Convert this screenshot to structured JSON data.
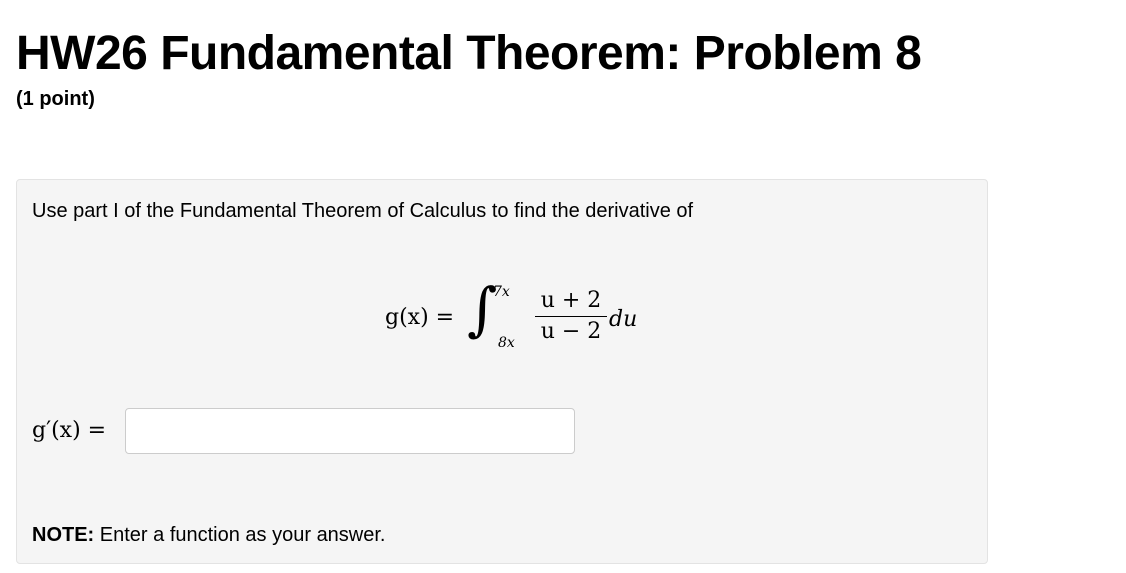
{
  "header": {
    "title": "HW26 Fundamental Theorem: Problem 8",
    "points": "(1 point)"
  },
  "problem": {
    "prompt": "Use part I of the Fundamental Theorem of Calculus to find the derivative of",
    "equation": {
      "lhs": "g(x) =",
      "integral_sign": "∫",
      "upper_limit": "7x",
      "lower_limit": "8x",
      "numerator": "u + 2",
      "denominator": "u − 2",
      "differential": "du"
    },
    "answer": {
      "label": "g′(x) =",
      "value": "",
      "placeholder": ""
    },
    "note": {
      "label": "NOTE:",
      "text": " Enter a function as your answer."
    }
  }
}
